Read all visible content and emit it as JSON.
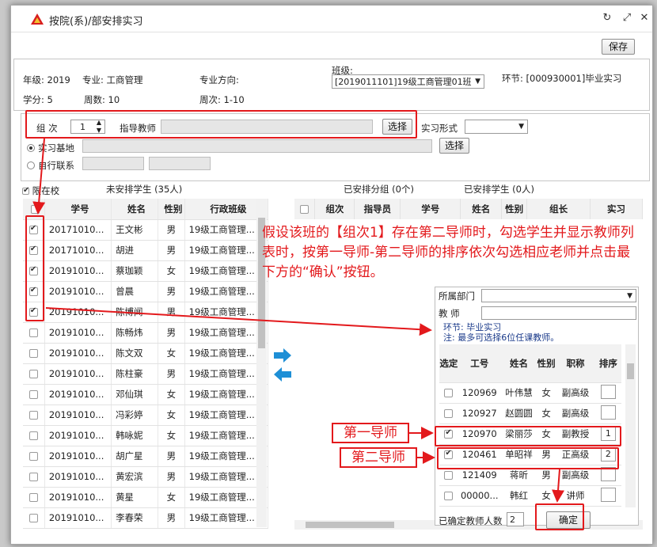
{
  "dialog": {
    "title": "按院(系)/部安排实习",
    "save_label": "保存"
  },
  "info": {
    "grade": "年级: 2019",
    "major": "专业: 工商管理",
    "direction": "专业方向:",
    "class_label": "班级:",
    "class_value": "[2019011101]19级工商管理01班",
    "stage": "环节: [000930001]毕业实习",
    "credits": "学分: 5",
    "weeks": "周数: 10",
    "week_range": "周次: 1-10"
  },
  "form": {
    "group_label": "组 次",
    "group_value": "1",
    "advisor_label": "指导教师",
    "choose": "选择",
    "mode_label": "实习形式",
    "base_label": "实习基地",
    "self_label": "自行联系"
  },
  "left": {
    "limit_label": "限在校",
    "unassigned": "未安排学生 (35人)",
    "headers": [
      "学号",
      "姓名",
      "性别",
      "行政班级"
    ],
    "rows": [
      {
        "id": "20171010...",
        "name": "王文彬",
        "sex": "男",
        "cls": "19级工商管理...",
        "checked": true
      },
      {
        "id": "20171010...",
        "name": "胡进",
        "sex": "男",
        "cls": "19级工商管理...",
        "checked": true
      },
      {
        "id": "20191010...",
        "name": "蔡珈颖",
        "sex": "女",
        "cls": "19级工商管理...",
        "checked": true
      },
      {
        "id": "20191010...",
        "name": "曾晨",
        "sex": "男",
        "cls": "19级工商管理...",
        "checked": true
      },
      {
        "id": "20191010...",
        "name": "陈博闻",
        "sex": "男",
        "cls": "19级工商管理...",
        "checked": true
      },
      {
        "id": "20191010...",
        "name": "陈畅炜",
        "sex": "男",
        "cls": "19级工商管理...",
        "checked": false
      },
      {
        "id": "20191010...",
        "name": "陈文双",
        "sex": "女",
        "cls": "19级工商管理...",
        "checked": false
      },
      {
        "id": "20191010...",
        "name": "陈柱豪",
        "sex": "男",
        "cls": "19级工商管理...",
        "checked": false
      },
      {
        "id": "20191010...",
        "name": "邓仙琪",
        "sex": "女",
        "cls": "19级工商管理...",
        "checked": false
      },
      {
        "id": "20191010...",
        "name": "冯彩婷",
        "sex": "女",
        "cls": "19级工商管理...",
        "checked": false
      },
      {
        "id": "20191010...",
        "name": "韩咏妮",
        "sex": "女",
        "cls": "19级工商管理...",
        "checked": false
      },
      {
        "id": "20191010...",
        "name": "胡广星",
        "sex": "男",
        "cls": "19级工商管理...",
        "checked": false
      },
      {
        "id": "20191010...",
        "name": "黄宏滨",
        "sex": "男",
        "cls": "19级工商管理...",
        "checked": false
      },
      {
        "id": "20191010...",
        "name": "黄星",
        "sex": "女",
        "cls": "19级工商管理...",
        "checked": false
      },
      {
        "id": "20191010...",
        "name": "李春荣",
        "sex": "男",
        "cls": "19级工商管理...",
        "checked": false
      }
    ]
  },
  "right": {
    "assigned_groups": "已安排分组 (0个)",
    "assigned_students": "已安排学生 (0人)",
    "headers": [
      "组次",
      "指导员",
      "学号",
      "姓名",
      "性别",
      "组长",
      "实习"
    ]
  },
  "annotation": "假设该班的【组次1】存在第二导师时，勾选学生并显示教师列表时，按第一导师-第二导师的排序依次勾选相应老师并点击最下方的“确认”按钮。",
  "popup": {
    "dept_label": "所属部门",
    "teacher_label": "教 师",
    "note1": "环节: 毕业实习",
    "note2": "注: 最多可选择6位任课教师。",
    "headers": [
      "选定",
      "工号",
      "姓名",
      "性别",
      "职称",
      "排序"
    ],
    "rows": [
      {
        "no": "120969",
        "name": "叶伟慧",
        "sex": "女",
        "title": "副高级",
        "order": "",
        "checked": false
      },
      {
        "no": "120927",
        "name": "赵圆圆",
        "sex": "女",
        "title": "副高级",
        "order": "",
        "checked": false
      },
      {
        "no": "120970",
        "name": "梁丽莎",
        "sex": "女",
        "title": "副教授",
        "order": "1",
        "checked": true
      },
      {
        "no": "120461",
        "name": "单昭祥",
        "sex": "男",
        "title": "正高级",
        "order": "2",
        "checked": true
      },
      {
        "no": "121409",
        "name": "蒋昕",
        "sex": "男",
        "title": "副高级",
        "order": "",
        "checked": false
      },
      {
        "no": "00000...",
        "name": "韩红",
        "sex": "女",
        "title": "讲师",
        "order": "",
        "checked": false
      }
    ],
    "count_label": "已确定教师人数",
    "count_value": "2",
    "confirm": "确定"
  },
  "labels": {
    "first": "第一导师",
    "second": "第二导师"
  },
  "colors": {
    "annotation": "#e3191c",
    "accent_arrow": "#1e8fd6"
  }
}
